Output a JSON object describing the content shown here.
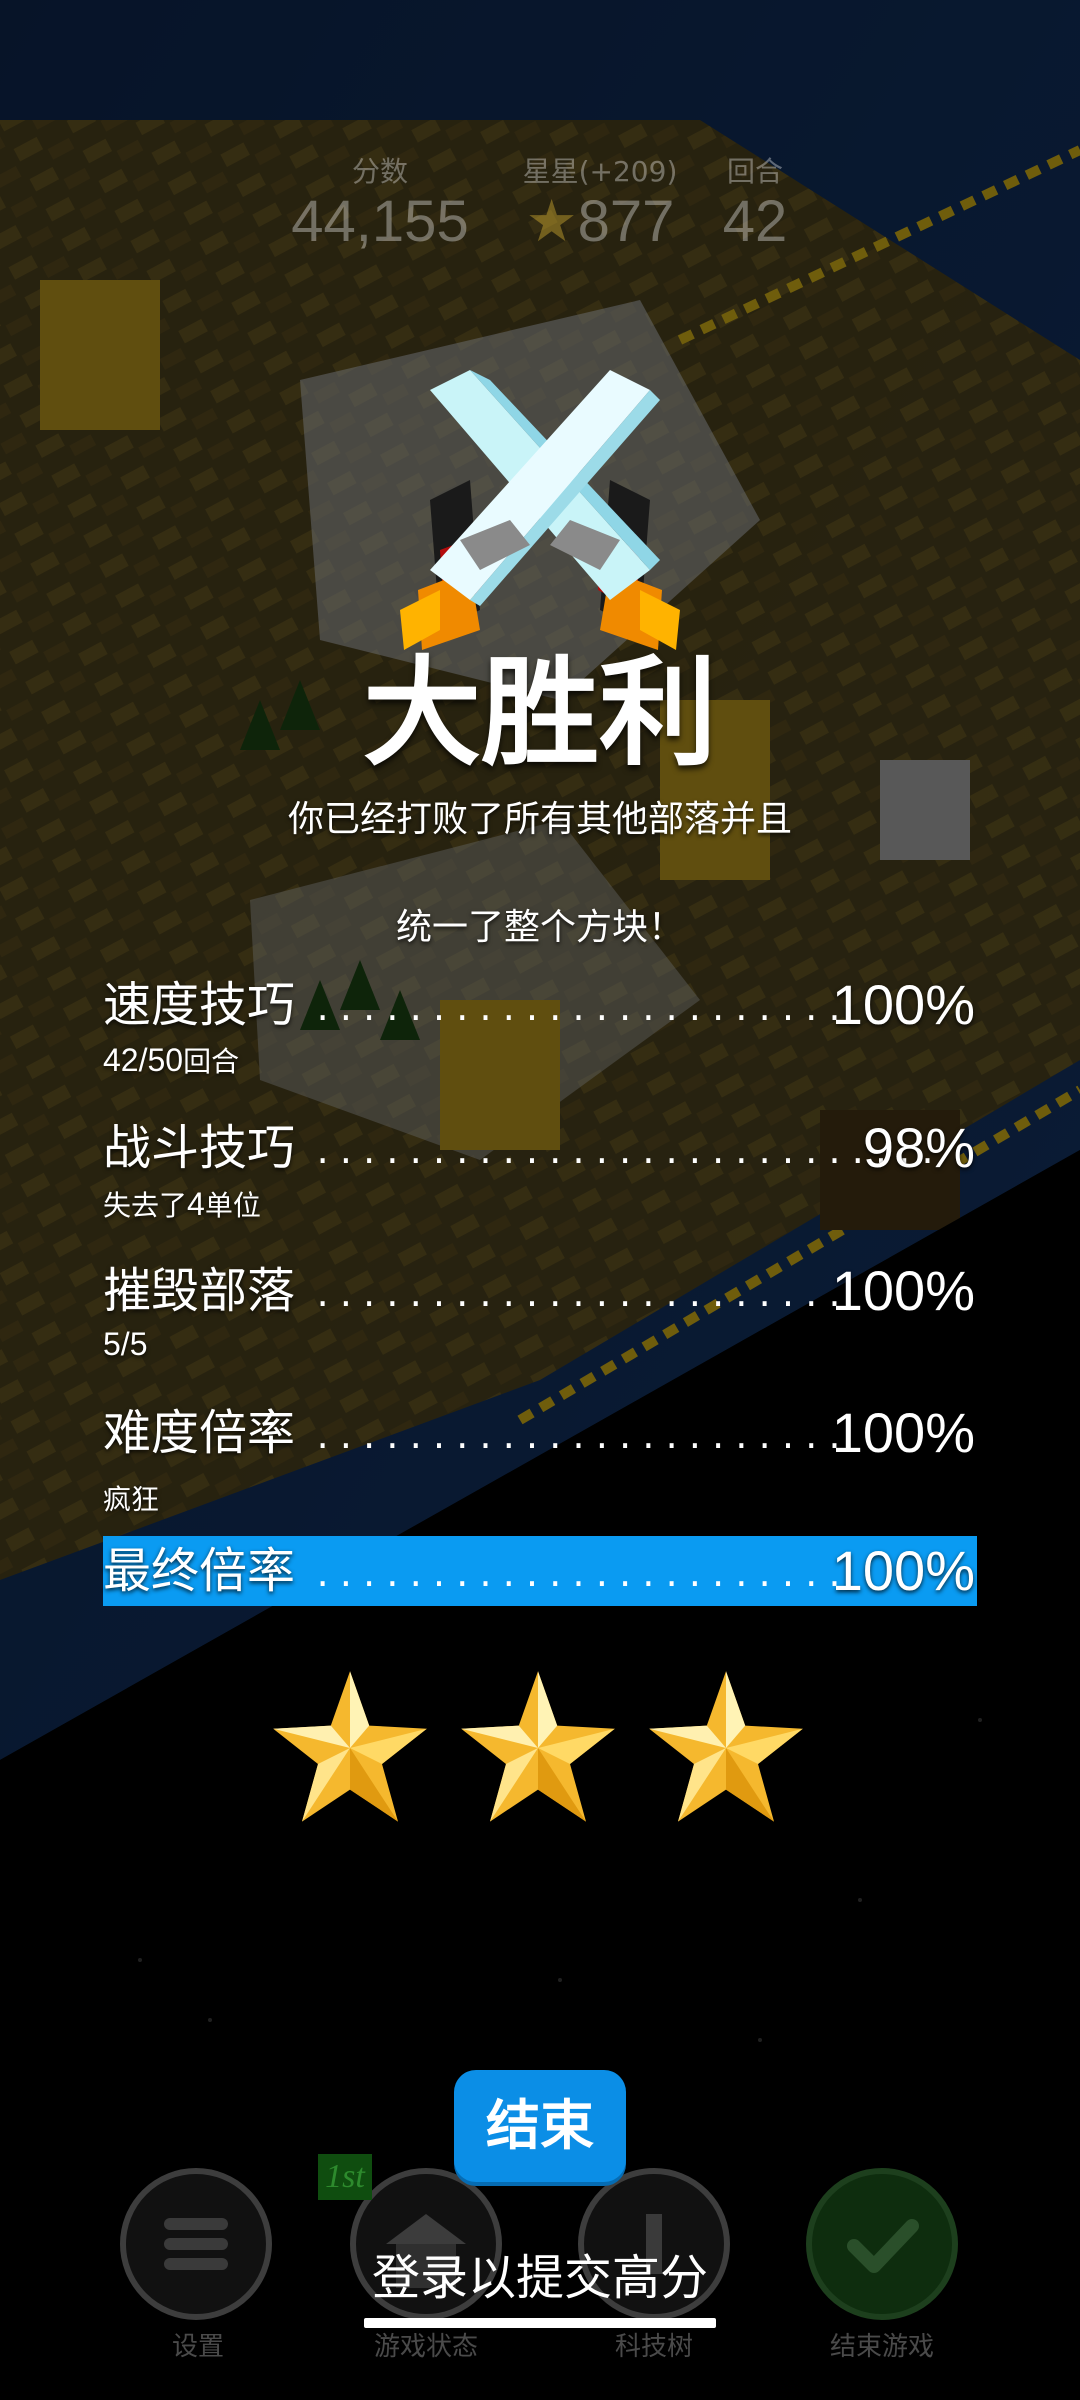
{
  "hud": {
    "score_label": "分数",
    "score_value": "44,155",
    "stars_label": "星星(+209)",
    "stars_value": "877",
    "turn_label": "回合",
    "turn_value": "42"
  },
  "result": {
    "title": "大胜利",
    "subtitle_line1": "你已经打败了所有其他部落并且",
    "subtitle_line2": "统一了整个方块！"
  },
  "rows": [
    {
      "label": "速度技巧",
      "value": "100%",
      "sub_num": "42/50",
      "sub_text": "回合"
    },
    {
      "label": "战斗技巧",
      "value": "98%",
      "sub_pre": "失去了",
      "sub_num": "4",
      "sub_text": "单位"
    },
    {
      "label": "摧毁部落",
      "value": "100%",
      "sub_num": "5/5"
    },
    {
      "label": "难度倍率",
      "value": "100%",
      "sub_text": "疯狂"
    },
    {
      "label": "最终倍率",
      "value": "100%"
    }
  ],
  "rating": {
    "stars_earned": 3,
    "stars_total": 3
  },
  "actions": {
    "finish_label": "结束",
    "login_label": "登录以提交高分"
  },
  "nav": {
    "settings": "设置",
    "game_status": "游戏状态",
    "tech_tree": "科技树",
    "end_game": "结束游戏",
    "rank_badge": "1st"
  },
  "colors": {
    "final_bar": "#0a9bf2",
    "finish_button": "#0b8ee6",
    "star_gold": "#f5b82e"
  }
}
